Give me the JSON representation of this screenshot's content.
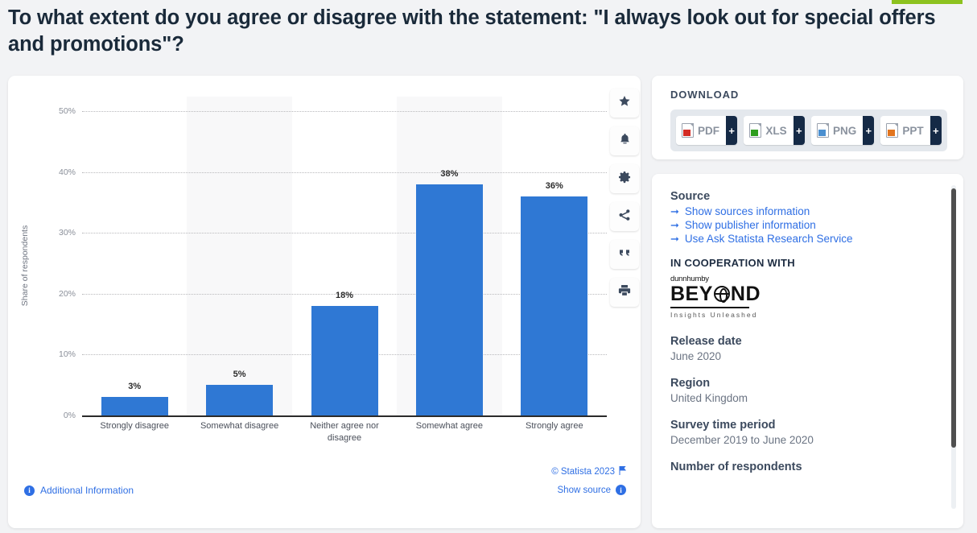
{
  "page_title": "To what extent do you agree or disagree with the statement: \"I always look out for special offers and promotions\"?",
  "chart_data": {
    "type": "bar",
    "title": "",
    "categories": [
      "Strongly disagree",
      "Somewhat disagree",
      "Neither agree nor disagree",
      "Somewhat agree",
      "Strongly agree"
    ],
    "values": [
      3,
      5,
      18,
      38,
      36
    ],
    "value_labels": [
      "3%",
      "5%",
      "18%",
      "38%",
      "36%"
    ],
    "xlabel": "",
    "ylabel": "Share of respondents",
    "ylim": [
      0,
      50
    ],
    "ytick_labels": [
      "0%",
      "10%",
      "20%",
      "30%",
      "40%",
      "50%"
    ],
    "ytick_values": [
      0,
      10,
      20,
      30,
      40,
      50
    ],
    "grid": true,
    "legend": "none",
    "bar_color": "#2f78d4",
    "band_color": "#f8f8f9"
  },
  "toolbar": {
    "items": [
      {
        "name": "star-icon",
        "label": "Favorite"
      },
      {
        "name": "bell-icon",
        "label": "Notify"
      },
      {
        "name": "gear-icon",
        "label": "Settings"
      },
      {
        "name": "share-icon",
        "label": "Share"
      },
      {
        "name": "quote-icon",
        "label": "Cite"
      },
      {
        "name": "print-icon",
        "label": "Print"
      }
    ]
  },
  "chart_footer": {
    "copyright": "© Statista 2023",
    "show_source": "Show source",
    "additional_information": "Additional Information",
    "info_glyph": "i"
  },
  "download": {
    "heading": "DOWNLOAD",
    "plus_glyph": "+",
    "buttons": [
      {
        "label": "PDF",
        "badge_color": "#d32b24"
      },
      {
        "label": "XLS",
        "badge_color": "#2f9e1f"
      },
      {
        "label": "PNG",
        "badge_color": "#4a8fd0"
      },
      {
        "label": "PPT",
        "badge_color": "#e2751f"
      }
    ]
  },
  "info_panel": {
    "source_heading": "Source",
    "links": [
      "Show sources information",
      "Show publisher information",
      "Use Ask Statista Research Service"
    ],
    "arrow_glyph": "➞",
    "cooperation_heading": "IN COOPERATION WITH",
    "logo": {
      "brand_small": "dunnhumby",
      "brand_left": "BEY",
      "brand_right": "ND",
      "tagline": "Insights Unleashed"
    },
    "fields": [
      {
        "label": "Release date",
        "value": "June 2020"
      },
      {
        "label": "Region",
        "value": "United Kingdom"
      },
      {
        "label": "Survey time period",
        "value": "December 2019 to June 2020"
      },
      {
        "label": "Number of respondents",
        "value": ""
      }
    ]
  },
  "colors": {
    "accent_green": "#8dc21f",
    "link_blue": "#2f6fe4",
    "bar_blue": "#2f78d4",
    "dark_navy": "#152a46"
  }
}
